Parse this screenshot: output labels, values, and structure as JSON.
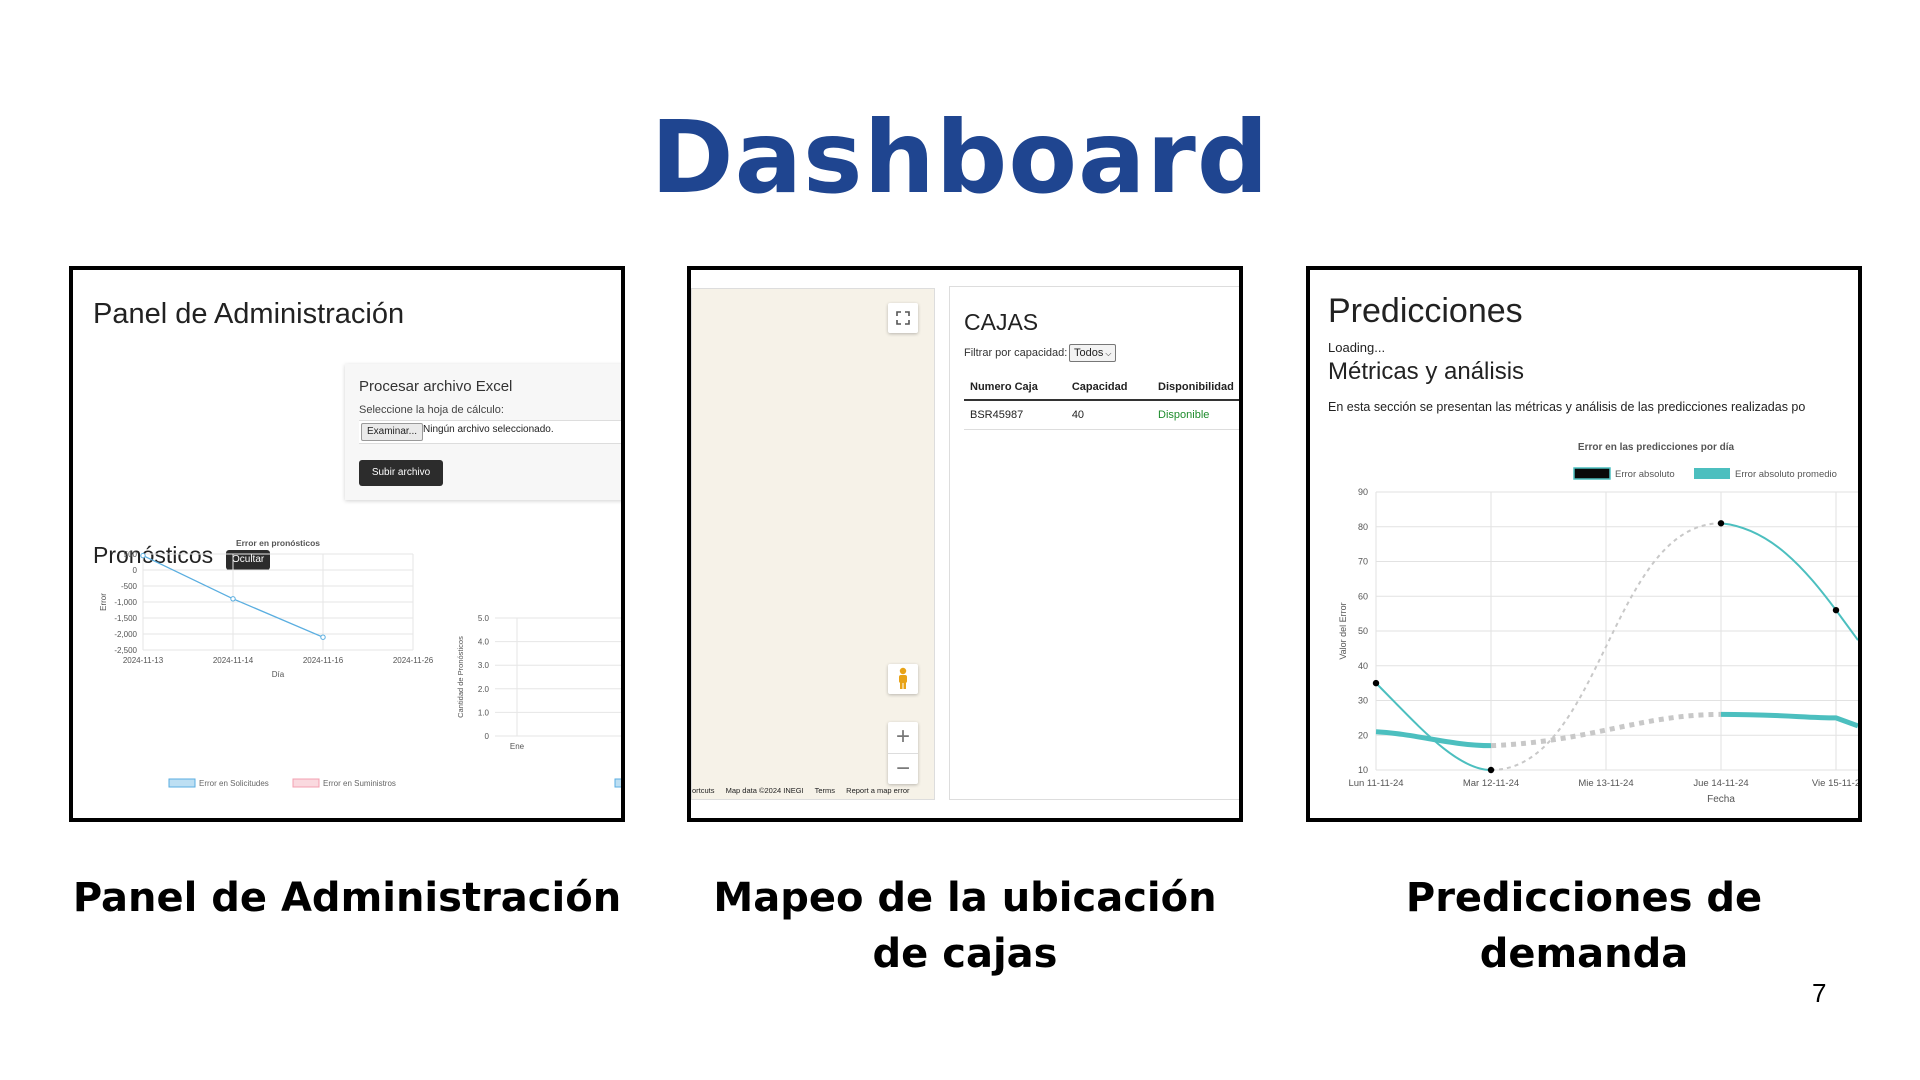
{
  "slide": {
    "title": "Dashboard",
    "page_number": "7",
    "captions": [
      "Panel de Administración",
      "Mapeo de la ubicación de cajas",
      "Predicciones de demanda"
    ]
  },
  "admin": {
    "title": "Panel de Administración",
    "excel": {
      "title": "Procesar archivo Excel",
      "label": "Seleccione la hoja de cálculo:",
      "browse_button": "Examinar...",
      "no_file": "Ningún archivo seleccionado.",
      "upload_button": "Subir archivo"
    },
    "forecast_title": "Pronósticos",
    "hide_button": "Ocultar"
  },
  "map": {
    "footer": [
      "ortcuts",
      "Map data ©2024 INEGI",
      "Terms",
      "Report a map error"
    ],
    "zoom_in": "+",
    "zoom_out": "−"
  },
  "boxes": {
    "title": "CAJAS",
    "filter_label": "Filtrar por capacidad:",
    "filter_value": "Todos",
    "columns": [
      "Numero Caja",
      "Capacidad",
      "Disponibilidad"
    ],
    "rows": [
      [
        "BSR45987",
        "40",
        "Disponible"
      ]
    ]
  },
  "predictions": {
    "title": "Predicciones",
    "loading": "Loading...",
    "metrics_title": "Métricas y análisis",
    "metrics_desc": "En esta sección se presentan las métricas y análisis de las predicciones realizadas po"
  },
  "chart_data": [
    {
      "type": "line",
      "title": "Error en pronósticos",
      "xlabel": "Día",
      "ylabel": "Error",
      "x": [
        "2024-11-13",
        "2024-11-14",
        "2024-11-16",
        "2024-11-26"
      ],
      "yticks": [
        "500",
        "0",
        "-500",
        "-1,000",
        "-1,500",
        "-2,000",
        "-2,500"
      ],
      "ylim": [
        -2500,
        500
      ],
      "series": [
        {
          "name": "Error en Solicitudes",
          "values": [
            450,
            -900,
            -2100,
            null
          ],
          "color": "#5aaee0"
        },
        {
          "name": "Error en Suministros",
          "values": [],
          "color": "#f3a0b0"
        }
      ],
      "legend": "bottom"
    },
    {
      "type": "line",
      "title": "",
      "xlabel": "",
      "ylabel": "Cantidad de Pronósticos",
      "x": [
        "Ene"
      ],
      "yticks": [
        "5.0",
        "4.0",
        "3.0",
        "2.0",
        "1.0",
        "0"
      ],
      "ylim": [
        0,
        5
      ]
    },
    {
      "type": "line",
      "title": "Error en las predicciones por día",
      "xlabel": "Fecha",
      "ylabel": "Valor del Error",
      "x": [
        "Lun 11-11-24",
        "Mar 12-11-24",
        "Mie 13-11-24",
        "Jue 14-11-24",
        "Vie 15-11-2"
      ],
      "ylim": [
        10,
        90
      ],
      "yticks": [
        "90",
        "80",
        "70",
        "60",
        "50",
        "40",
        "30",
        "20",
        "10"
      ],
      "series": [
        {
          "name": "Error absoluto",
          "values": [
            35,
            10,
            null,
            81,
            56
          ],
          "color": "#4cbfbf"
        },
        {
          "name": "Error absoluto promedio",
          "values": [
            21,
            17,
            null,
            26,
            25
          ],
          "color": "#4cbfbf"
        }
      ],
      "legend": "top",
      "grid": true
    }
  ]
}
